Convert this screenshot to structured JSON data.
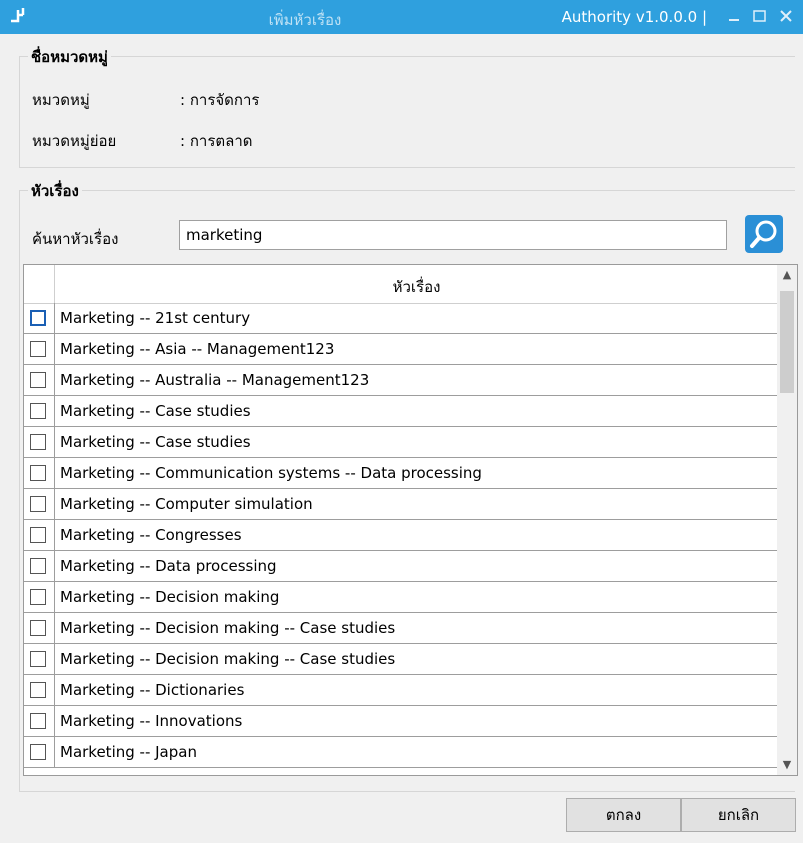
{
  "window": {
    "title": "เพิ่มหัวเรื่อง",
    "version": "Authority v1.0.0.0 |",
    "minimize_glyph": "_",
    "maximize_glyph": "□",
    "close_glyph": "✕"
  },
  "category_group": {
    "legend": "ชื่อหมวดหมู่",
    "category_label": "หมวดหมู่",
    "category_value": ":  การจัดการ",
    "subcategory_label": "หมวดหมู่ย่อย",
    "subcategory_value": ":  การตลาด"
  },
  "subject_group": {
    "legend": "หัวเรื่อง",
    "search_label": "ค้นหาหัวเรื่อง",
    "search_value": "marketing",
    "grid_header": "หัวเรื่อง",
    "rows": [
      "Marketing -- 21st century",
      "Marketing -- Asia -- Management123",
      "Marketing -- Australia -- Management123",
      "Marketing -- Case studies",
      "Marketing -- Case studies",
      "Marketing -- Communication systems -- Data processing",
      "Marketing -- Computer simulation",
      "Marketing -- Congresses",
      "Marketing -- Data processing",
      "Marketing -- Decision making",
      "Marketing -- Decision making -- Case studies",
      "Marketing -- Decision making -- Case studies",
      "Marketing -- Dictionaries",
      "Marketing -- Innovations",
      "Marketing -- Japan"
    ]
  },
  "buttons": {
    "ok": "ตกลง",
    "cancel": "ยกเลิก"
  },
  "colors": {
    "titlebar": "#2fa0de",
    "search_button": "#2a8fd6"
  },
  "icons": {
    "app": "app-icon",
    "search": "search-icon",
    "scroll_up": "chevron-up-icon",
    "scroll_down": "chevron-down-icon"
  }
}
